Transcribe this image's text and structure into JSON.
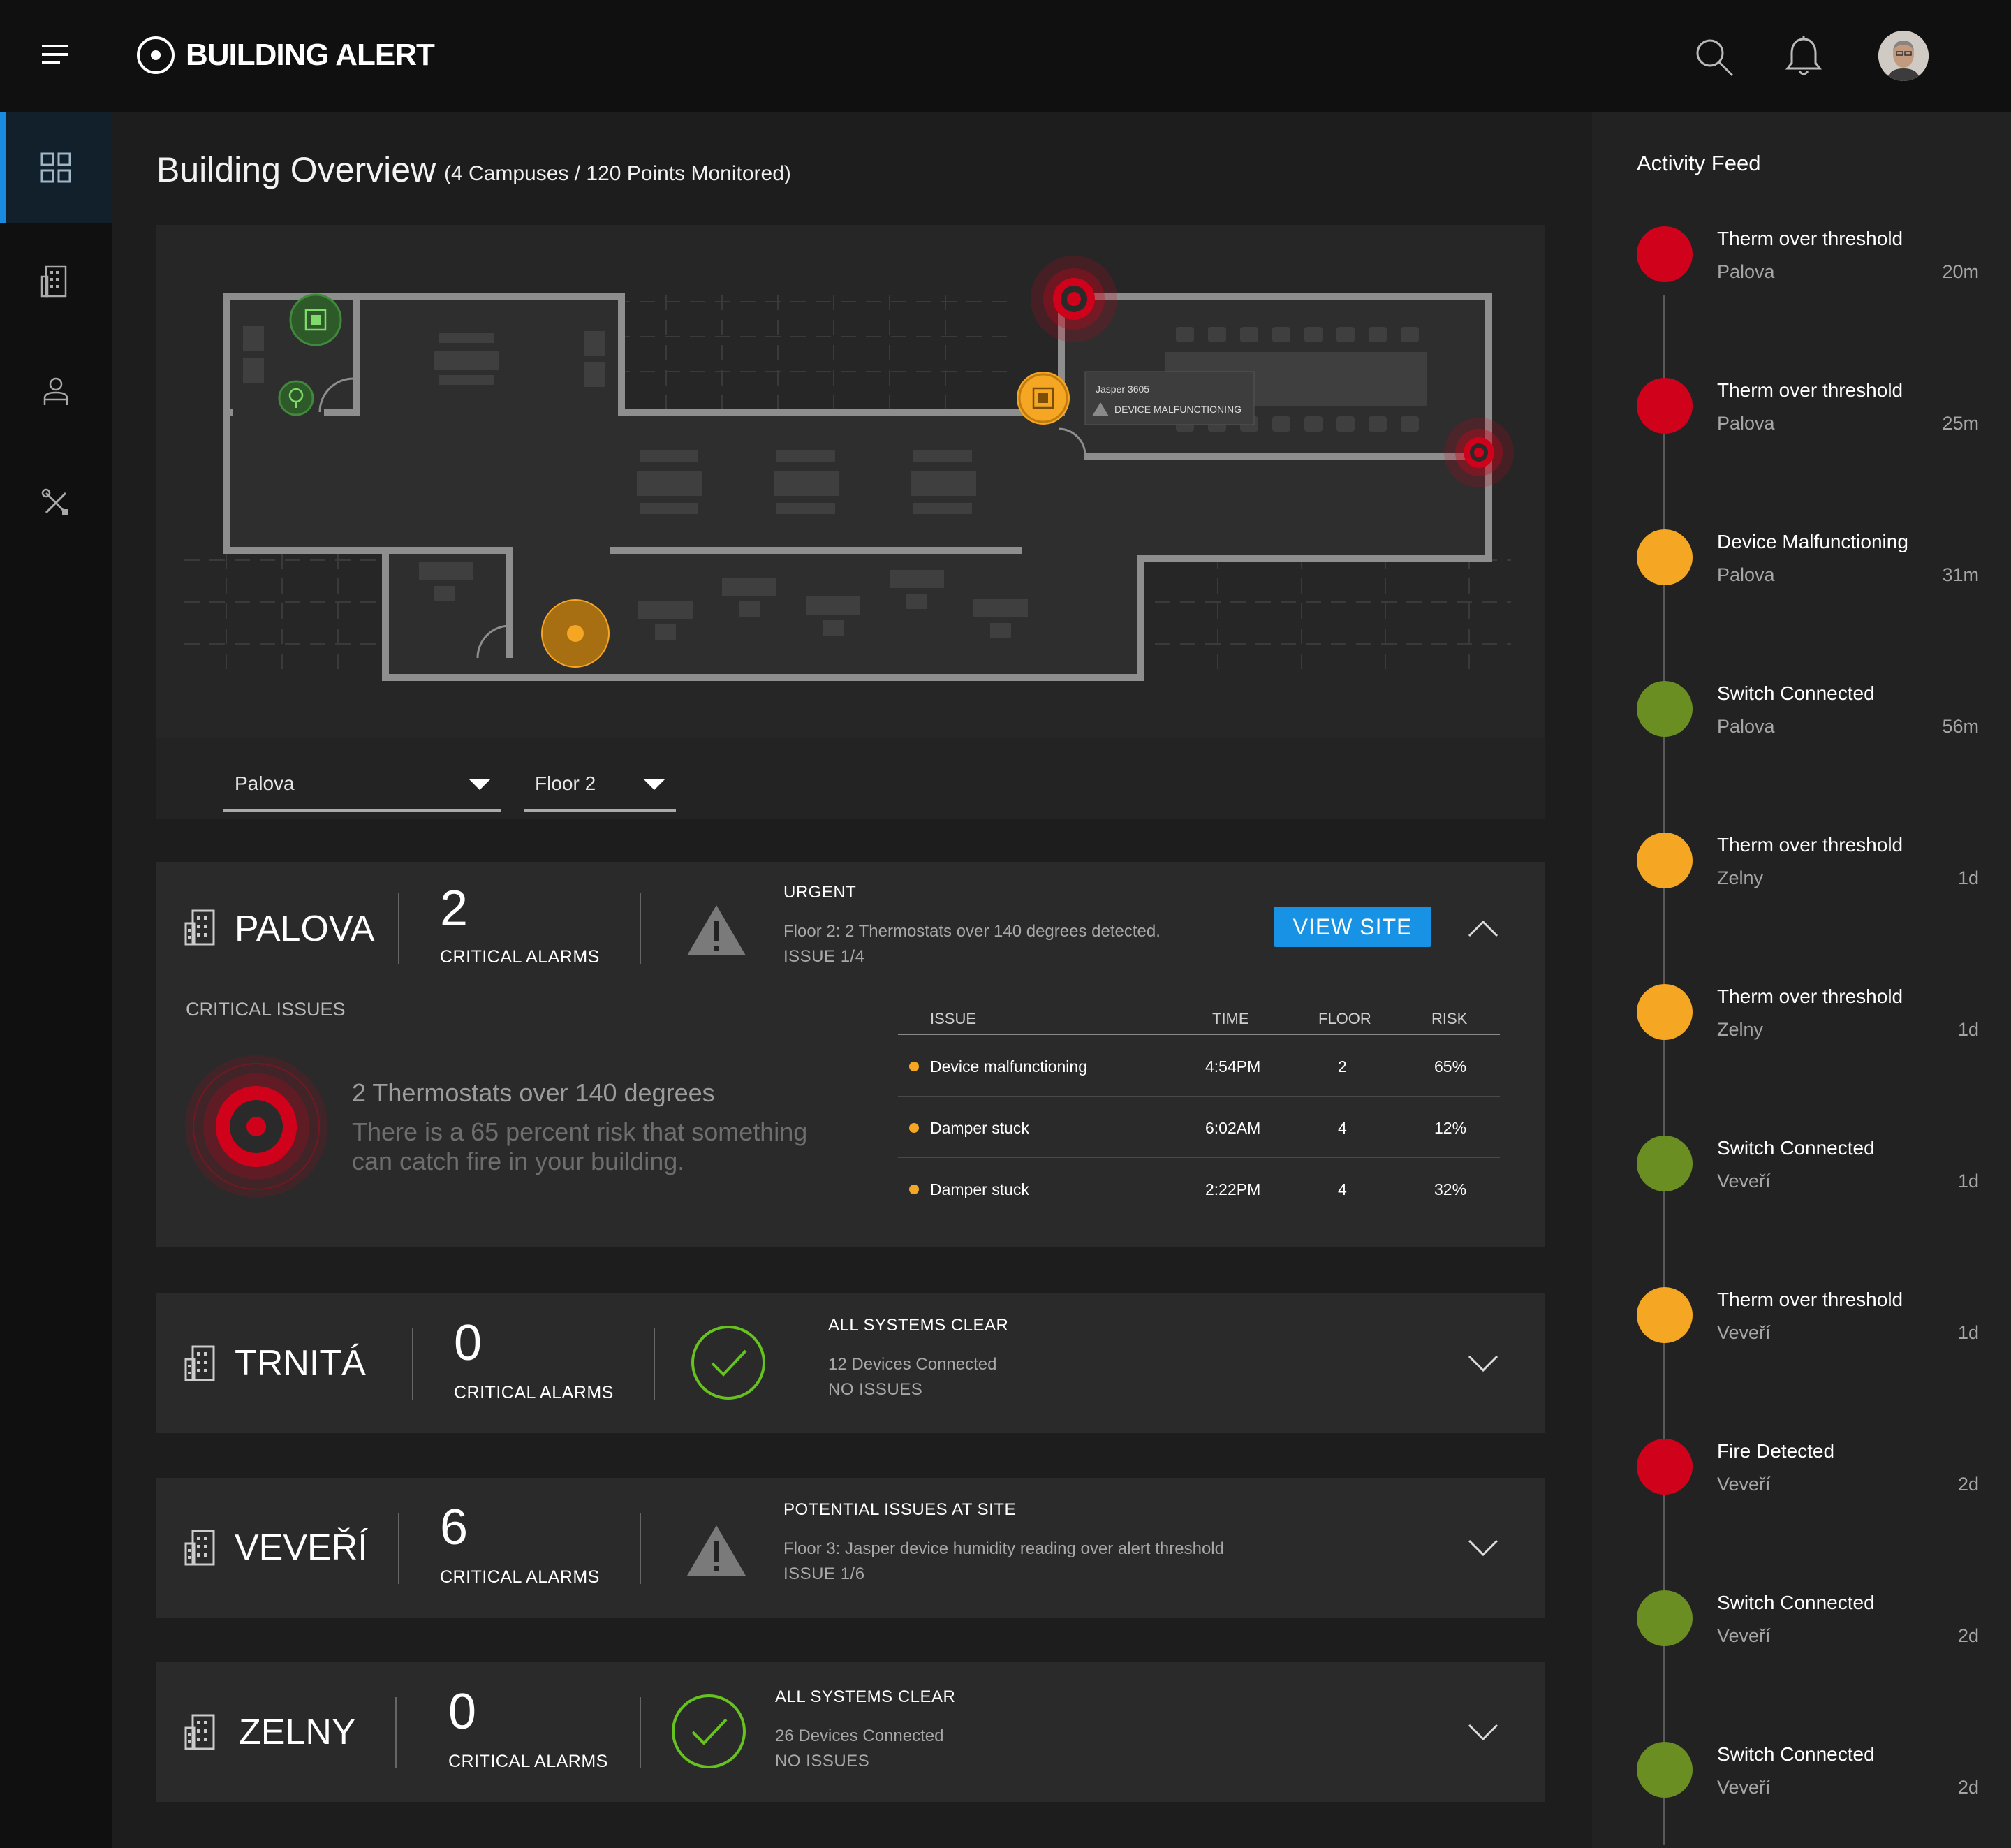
{
  "app": {
    "title": "BUILDING ALERT"
  },
  "colors": {
    "critical": "#d0021b",
    "warning": "#f5a623",
    "ok": "#6b8e23",
    "accent": "#1792e5"
  },
  "header": {
    "icons": [
      "menu-icon",
      "search-icon",
      "bell-icon",
      "avatar"
    ]
  },
  "sidebar": {
    "items": [
      {
        "name": "dashboard",
        "icon": "grid-icon",
        "active": true
      },
      {
        "name": "buildings",
        "icon": "building-icon",
        "active": false
      },
      {
        "name": "users",
        "icon": "user-icon",
        "active": false
      },
      {
        "name": "tools",
        "icon": "tools-icon",
        "active": false
      }
    ]
  },
  "main": {
    "title": "Building Overview",
    "subtitle": "(4 Campuses / 120 Points Monitored)"
  },
  "map": {
    "tooltip": {
      "device": "Jasper 3605",
      "status": "DEVICE MALFUNCTIONING"
    },
    "campus_select": "Palova",
    "floor_select": "Floor 2"
  },
  "sites": [
    {
      "name": "PALOVA",
      "alarm_count": "2",
      "alarm_label": "CRITICAL ALARMS",
      "status_title": "URGENT",
      "status_desc": "Floor 2:  2 Thermostats over 140 degrees detected.",
      "status_issue": "ISSUE 1/4",
      "button": "VIEW SITE",
      "critical_label": "CRITICAL ISSUES",
      "critical_title": "2 Thermostats over 140 degrees",
      "critical_desc": "There is a 65 percent risk that something can catch fire in your building.",
      "table": {
        "headers": [
          "ISSUE",
          "TIME",
          "FLOOR",
          "RISK"
        ],
        "rows": [
          {
            "issue": "Device malfunctioning",
            "time": "4:54PM",
            "floor": "2",
            "risk": "65%"
          },
          {
            "issue": "Damper stuck",
            "time": "6:02AM",
            "floor": "4",
            "risk": "12%"
          },
          {
            "issue": "Damper stuck",
            "time": "2:22PM",
            "floor": "4",
            "risk": "32%"
          }
        ]
      }
    },
    {
      "name": "TRNITÁ",
      "alarm_count": "0",
      "alarm_label": "CRITICAL ALARMS",
      "status_title": "ALL SYSTEMS CLEAR",
      "status_desc": "12 Devices Connected",
      "status_issue": "NO ISSUES"
    },
    {
      "name": "VEVEŘÍ",
      "alarm_count": "6",
      "alarm_label": "CRITICAL ALARMS",
      "status_title": "POTENTIAL ISSUES AT SITE",
      "status_desc": "Floor 3:  Jasper device humidity reading over alert threshold",
      "status_issue": "ISSUE 1/6"
    },
    {
      "name": "ZELNY",
      "alarm_count": "0",
      "alarm_label": "CRITICAL ALARMS",
      "status_title": "ALL SYSTEMS CLEAR",
      "status_desc": "26 Devices Connected",
      "status_issue": "NO ISSUES"
    }
  ],
  "feed": {
    "title": "Activity Feed",
    "items": [
      {
        "title": "Therm over threshold",
        "site": "Palova",
        "time": "20m",
        "severity": "critical"
      },
      {
        "title": "Therm over threshold",
        "site": "Palova",
        "time": "25m",
        "severity": "critical"
      },
      {
        "title": "Device Malfunctioning",
        "site": "Palova",
        "time": "31m",
        "severity": "warning"
      },
      {
        "title": "Switch Connected",
        "site": "Palova",
        "time": "56m",
        "severity": "ok"
      },
      {
        "title": "Therm over threshold",
        "site": "Zelny",
        "time": "1d",
        "severity": "warning"
      },
      {
        "title": "Therm over threshold",
        "site": "Zelny",
        "time": "1d",
        "severity": "warning"
      },
      {
        "title": "Switch Connected",
        "site": "Veveří",
        "time": "1d",
        "severity": "ok"
      },
      {
        "title": "Therm over threshold",
        "site": "Veveří",
        "time": "1d",
        "severity": "warning"
      },
      {
        "title": "Fire Detected",
        "site": "Veveří",
        "time": "2d",
        "severity": "critical"
      },
      {
        "title": "Switch Connected",
        "site": "Veveří",
        "time": "2d",
        "severity": "ok"
      },
      {
        "title": "Switch Connected",
        "site": "Veveří",
        "time": "2d",
        "severity": "ok"
      }
    ]
  }
}
